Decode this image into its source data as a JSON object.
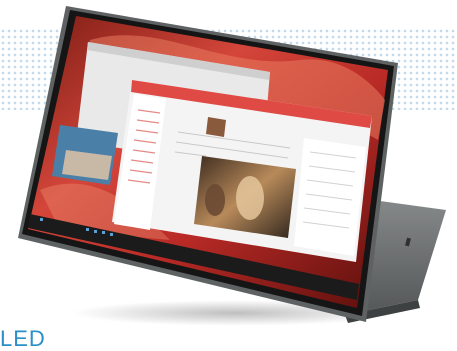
{
  "caption": {
    "text": "LED"
  },
  "device": {
    "type": "convertible laptop in tent mode",
    "body_color": "#6f7273",
    "screen_bezel_color": "#1a1a1a",
    "wallpaper_colors": [
      "#c2302a",
      "#e05a3c",
      "#6b1410"
    ],
    "taskbar_color": "#1b1b1b"
  },
  "screen": {
    "windows": [
      {
        "name": "background-browser-window"
      },
      {
        "name": "music-app-window",
        "accent": "#e04a45"
      }
    ]
  },
  "decor": {
    "dot_pattern_color": "#bcd6ea"
  }
}
